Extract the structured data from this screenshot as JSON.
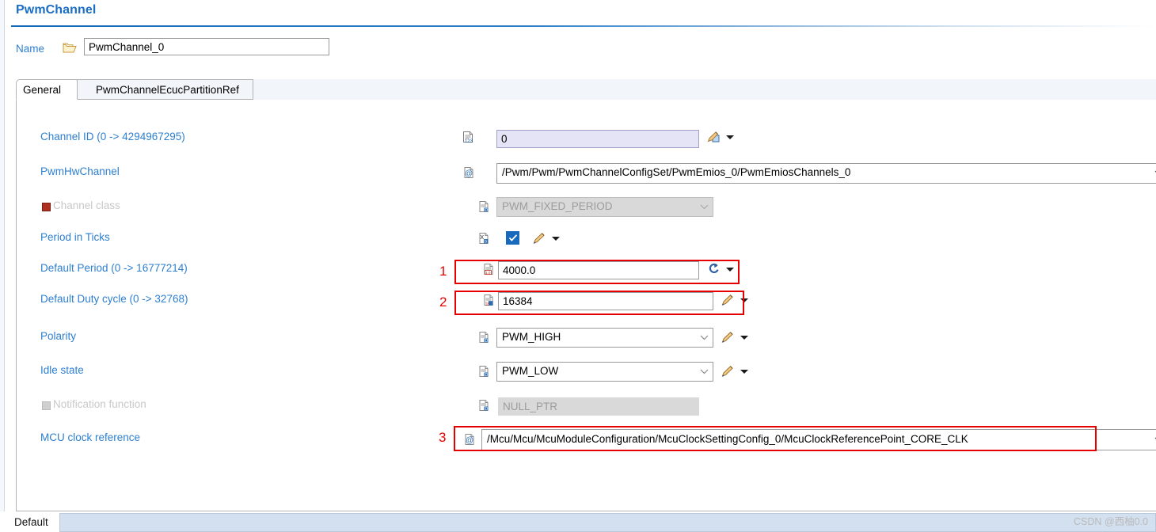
{
  "header": {
    "title": "PwmChannel"
  },
  "name_row": {
    "label": "Name",
    "icon": "folder-icon",
    "value": "PwmChannel_0"
  },
  "tabs": [
    {
      "label": "General",
      "selected": true
    },
    {
      "label": "PwmChannelEcucPartitionRef",
      "selected": false
    }
  ],
  "fields": [
    {
      "label": "Channel ID (0 -> 4294967295)",
      "icon": "int-attribute-icon",
      "value": "0",
      "control": "text",
      "state": "editable-highlight",
      "has_edit": true,
      "marker": null
    },
    {
      "label": "PwmHwChannel",
      "icon": "reference-at-icon",
      "value": "/Pwm/Pwm/PwmChannelConfigSet/PwmEmios_0/PwmEmiosChannels_0",
      "control": "combo-wide",
      "state": "editable",
      "has_edit": false,
      "marker": null
    },
    {
      "label": "Channel class",
      "icon": "enum-attribute-icon",
      "value": "PWM_FIXED_PERIOD",
      "control": "combo",
      "state": "disabled",
      "has_edit": false,
      "marker": "red"
    },
    {
      "label": "Period in Ticks",
      "icon": "bool-attribute-icon",
      "value": "",
      "control": "checkbox",
      "state": "checked",
      "has_edit": true,
      "marker": null
    },
    {
      "label": "Default Period (0 -> 16777214)",
      "icon": "float-attribute-icon",
      "value": "4000.0",
      "control": "text",
      "state": "editable",
      "has_edit": true,
      "edit_icon": "recalculate-icon",
      "marker": null,
      "annotation": "1"
    },
    {
      "label": "Default Duty cycle (0 -> 32768)",
      "icon": "int-attribute-icon",
      "value": "16384",
      "control": "text",
      "state": "editable",
      "has_edit": true,
      "edit_icon": "pencil-icon",
      "marker": null,
      "annotation": "2"
    },
    {
      "label": "Polarity",
      "icon": "enum-attribute-icon",
      "value": "PWM_HIGH",
      "control": "combo",
      "state": "editable",
      "has_edit": true,
      "edit_icon": "pencil-icon",
      "marker": null
    },
    {
      "label": "Idle state",
      "icon": "enum-attribute-icon",
      "value": "PWM_LOW",
      "control": "combo",
      "state": "editable",
      "has_edit": true,
      "edit_icon": "pencil-icon",
      "marker": null
    },
    {
      "label": "Notification function",
      "icon": "enum-attribute-icon",
      "value": "NULL_PTR",
      "control": "text",
      "state": "disabled",
      "has_edit": false,
      "marker": "gray"
    },
    {
      "label": "MCU clock reference",
      "icon": "reference-at-icon",
      "value": "/Mcu/Mcu/McuModuleConfiguration/McuClockSettingConfig_0/McuClockReferencePoint_CORE_CLK",
      "control": "combo-wide",
      "state": "editable",
      "has_edit": false,
      "marker": null,
      "annotation": "3"
    }
  ],
  "annotations": [
    {
      "number": "1"
    },
    {
      "number": "2"
    },
    {
      "number": "3"
    }
  ],
  "footer": {
    "default_label": "Default",
    "default_value": ""
  },
  "watermark": "CSDN @西柚0.0",
  "colors": {
    "accent_blue": "#2d7fd0",
    "title_blue": "#1a6fc4",
    "annotation_red": "#e60000",
    "checkbox_blue": "#1769bd",
    "highlight_field": "#e5e4f7",
    "disabled_field": "#d9d9d9"
  }
}
